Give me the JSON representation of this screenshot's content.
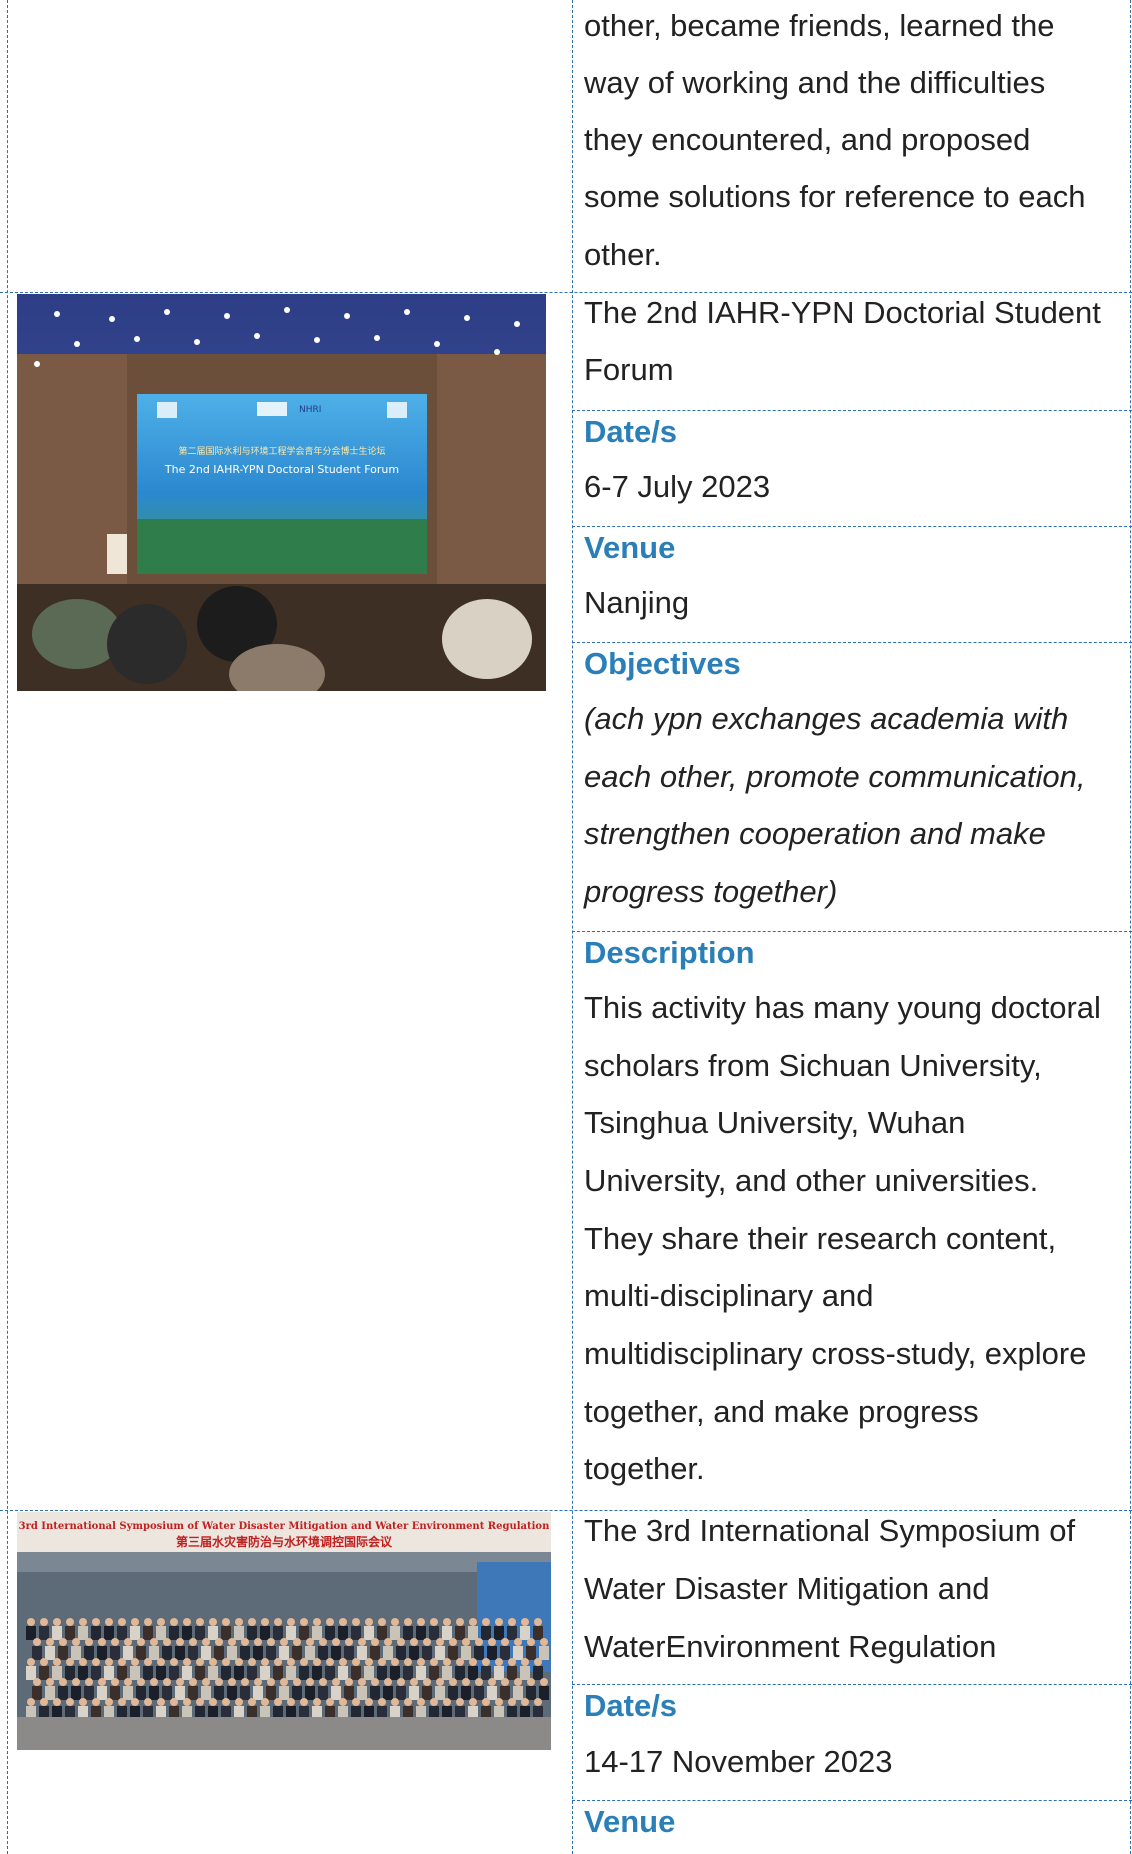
{
  "rows": [
    {
      "continued_text": [
        "other, became friends, learned the",
        "way of working and the difficulties",
        "they encountered, and proposed",
        "some solutions for reference to each",
        "other."
      ]
    },
    {
      "title": [
        "The 2nd IAHR-YPN Doctorial Student",
        "Forum"
      ],
      "date_label": "Date/s",
      "date_value": "6-7 July 2023",
      "venue_label": "Venue",
      "venue_value": "Nanjing",
      "objectives_label": "Objectives",
      "objectives_text": [
        "(ach ypn exchanges academia with",
        "each other, promote communication,",
        "strengthen cooperation and make",
        "progress together)"
      ],
      "description_label": "Description",
      "description_text": [
        "This activity has many young doctoral",
        "scholars from Sichuan University,",
        "Tsinghua University, Wuhan",
        "University, and other universities.",
        "They share their research content,",
        "multi-disciplinary and",
        "multidisciplinary cross-study, explore",
        "together, and make progress",
        "together."
      ],
      "photo": {
        "screen_title_cn": "第二届国际水利与环境工程学会青年分会博士生论坛",
        "screen_title_en": "The 2nd  IAHR-YPN Doctoral Student Forum",
        "screen_logo": "NHRI"
      }
    },
    {
      "title": [
        "The 3rd International Symposium of",
        "Water Disaster Mitigation and",
        "WaterEnvironment Regulation"
      ],
      "date_label": "Date/s",
      "date_value": "14-17 November 2023",
      "venue_label": "Venue",
      "photo": {
        "banner_en": "3rd International Symposium of Water Disaster Mitigation and Water Environment Regulation",
        "banner_cn": "第三届水灾害防治与水环境调控国际会议"
      }
    }
  ]
}
